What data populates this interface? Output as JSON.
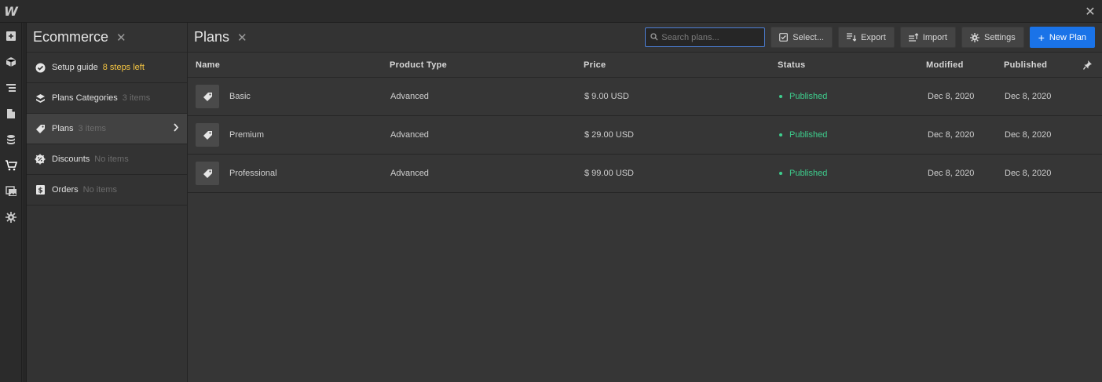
{
  "app": {
    "logo": "W",
    "close": "✕"
  },
  "rail": {
    "items": [
      {
        "name": "add-panel-icon"
      },
      {
        "name": "cube-icon"
      },
      {
        "name": "navigator-icon"
      },
      {
        "name": "pages-icon"
      },
      {
        "name": "cms-icon"
      },
      {
        "name": "ecommerce-cart-icon"
      },
      {
        "name": "assets-icon"
      },
      {
        "name": "settings-gear-icon"
      }
    ]
  },
  "sidebar": {
    "title": "Ecommerce",
    "close": "✕",
    "items": [
      {
        "label": "Setup guide",
        "meta": "8 steps left",
        "icon": "check-circle-icon"
      },
      {
        "label": "Plans Categories",
        "meta": "3 items",
        "icon": "category-icon"
      },
      {
        "label": "Plans",
        "meta": "3 items",
        "icon": "tag-icon",
        "chevron": "›"
      },
      {
        "label": "Discounts",
        "meta": "No items",
        "icon": "discount-badge-icon"
      },
      {
        "label": "Orders",
        "meta": "No items",
        "icon": "order-receipt-icon"
      }
    ]
  },
  "main": {
    "title": "Plans",
    "close": "✕",
    "search": {
      "placeholder": "Search plans..."
    },
    "buttons": {
      "select": "Select...",
      "export": "Export",
      "import": "Import",
      "settings": "Settings",
      "new": "New Plan",
      "new_prefix": "+"
    },
    "columns": {
      "name": "Name",
      "product_type": "Product Type",
      "price": "Price",
      "status": "Status",
      "modified": "Modified",
      "published": "Published"
    },
    "rows": [
      {
        "name": "Basic",
        "product_type": "Advanced",
        "price": "$ 9.00 USD",
        "status": "Published",
        "modified": "Dec 8, 2020",
        "published": "Dec 8, 2020"
      },
      {
        "name": "Premium",
        "product_type": "Advanced",
        "price": "$ 29.00 USD",
        "status": "Published",
        "modified": "Dec 8, 2020",
        "published": "Dec 8, 2020"
      },
      {
        "name": "Professional",
        "product_type": "Advanced",
        "price": "$ 99.00 USD",
        "status": "Published",
        "modified": "Dec 8, 2020",
        "published": "Dec 8, 2020"
      }
    ]
  },
  "colors": {
    "accent": "#1a73e8",
    "published": "#3ecf8e",
    "warning": "#f5c542"
  }
}
